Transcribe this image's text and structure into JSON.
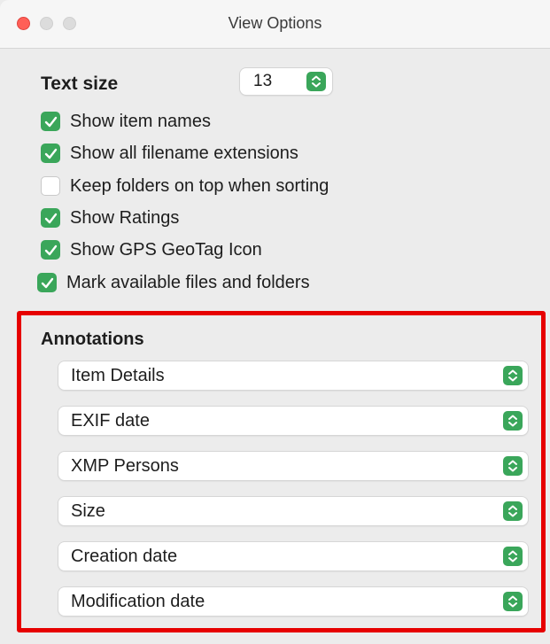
{
  "window": {
    "title": "View Options"
  },
  "text_size": {
    "label": "Text size",
    "value": "13"
  },
  "checkboxes": [
    {
      "label": "Show item names",
      "checked": true
    },
    {
      "label": "Show all filename extensions",
      "checked": true
    },
    {
      "label": "Keep folders on top when sorting",
      "checked": false
    },
    {
      "label": "Show Ratings",
      "checked": true
    },
    {
      "label": "Show GPS GeoTag Icon",
      "checked": true
    },
    {
      "label": "Mark available files and folders",
      "checked": true
    }
  ],
  "annotations": {
    "title": "Annotations",
    "selects": [
      "Item Details",
      "EXIF date",
      "XMP Persons",
      "Size",
      "Creation date",
      "Modification date"
    ]
  },
  "colors": {
    "accent": "#3aa65a",
    "highlight_frame": "#e60000",
    "close_button": "#ff5f57"
  }
}
